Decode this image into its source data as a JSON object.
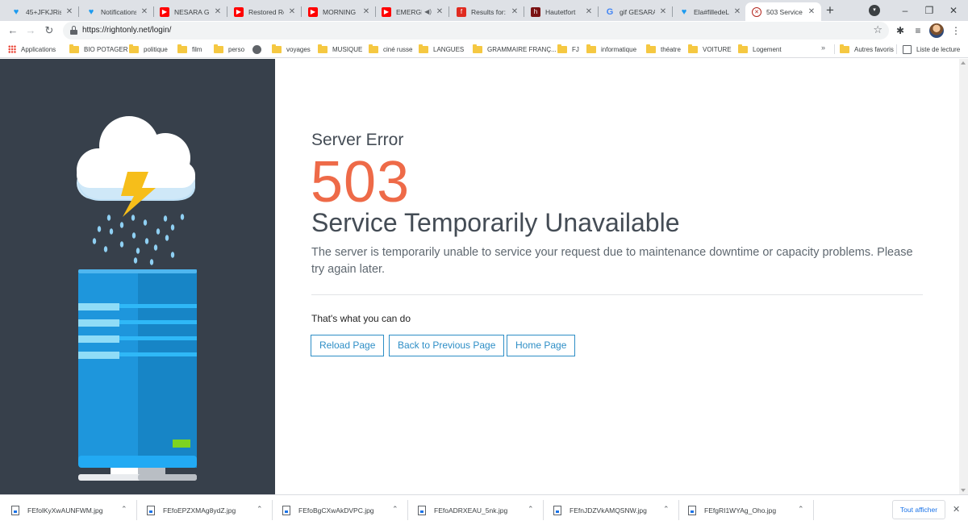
{
  "tabs": [
    {
      "title": "45+JFKJRisal",
      "icon": "twitter-icon",
      "glyph": "♥"
    },
    {
      "title": "Notifications",
      "icon": "twitter-icon",
      "glyph": "♥"
    },
    {
      "title": "NESARA GES",
      "icon": "youtube-icon",
      "glyph": "▶"
    },
    {
      "title": "Restored Re",
      "icon": "youtube-icon",
      "glyph": "▶"
    },
    {
      "title": "MORNING B",
      "icon": "youtube-icon",
      "glyph": "▶"
    },
    {
      "title": "EMERGE",
      "icon": "youtube-icon",
      "glyph": "▶",
      "audio": "◀)"
    },
    {
      "title": "Results for: V",
      "icon": "results-icon",
      "glyph": "f"
    },
    {
      "title": "Hautetfort",
      "icon": "hautefort-icon",
      "glyph": "h"
    },
    {
      "title": "gif GESARA",
      "icon": "google-icon",
      "glyph": "G"
    },
    {
      "title": "Ela#filledeLu",
      "icon": "twitter-icon",
      "glyph": "♥"
    },
    {
      "title": "503 Service T",
      "icon": "error-icon",
      "glyph": "✕",
      "active": true
    }
  ],
  "toolbar": {
    "url": "https://rightonly.net/login/"
  },
  "bookmarks": {
    "apps": "Applications",
    "items": [
      "BIO POTAGER",
      "politique",
      "film",
      "perso",
      "voyages",
      "MUSIQUE",
      "ciné russe",
      "LANGUES",
      "GRAMMAIRE FRANÇ...",
      "FJ",
      "informatique",
      "théatre",
      "VOITURE",
      "Logement"
    ],
    "more": "»",
    "other": "Autres favoris",
    "reading_list": "Liste de lecture"
  },
  "error": {
    "label": "Server Error",
    "code": "503",
    "title": "Service Temporarily Unavailable",
    "description": "The server is temporarily unable to service your request due to maintenance downtime or capacity problems. Please try again later.",
    "actions_heading": "That's what you can do",
    "buttons": {
      "reload": "Reload Page",
      "back": "Back to Previous Page",
      "home": "Home Page"
    }
  },
  "colors": {
    "panel_bg": "#37404b",
    "accent_code": "#ee6a48",
    "button_blue": "#2d8ec6",
    "server_blue": "#1e96dc",
    "led_green": "#7ed321",
    "bolt_yellow": "#f6be1a"
  },
  "downloads": {
    "files": [
      "FEfolKyXwAUNFWM.jpg",
      "FEfoEPZXMAg8ydZ.jpg",
      "FEfoBgCXwAkDVPC.jpg",
      "FEfoADRXEAU_5nk.jpg",
      "FEfnJDZVkAMQSNW.jpg",
      "FEfgRI1WYAg_Oho.jpg"
    ],
    "show_all": "Tout afficher"
  }
}
